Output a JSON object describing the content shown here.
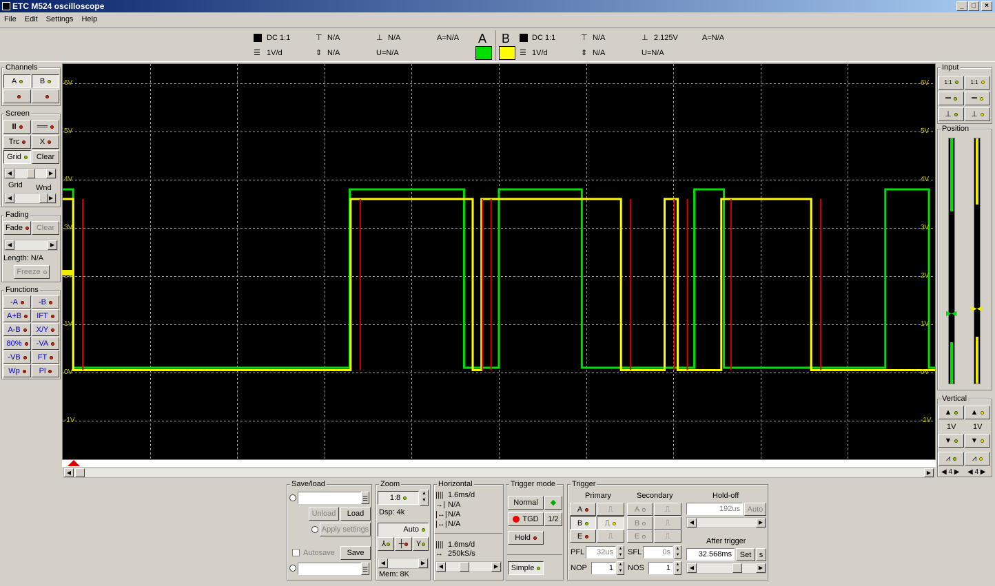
{
  "window": {
    "title": "ETC M524 oscilloscope",
    "min": "_",
    "max": "□",
    "close": "×"
  },
  "menu": [
    "File",
    "Edit",
    "Settings",
    "Help"
  ],
  "header": {
    "a_big": "A",
    "b_big": "B",
    "a": {
      "coupling": "DC 1:1",
      "scale": "1V/d",
      "v1": "N/A",
      "v2": "N/A",
      "trig": "N/A",
      "u": "U=N/A",
      "eq": "A=N/A"
    },
    "b": {
      "coupling": "DC 1:1",
      "scale": "1V/d",
      "v1": "N/A",
      "v2": "N/A",
      "trig": "2.125V",
      "u": "U=N/A",
      "eq": "A=N/A"
    },
    "a_color": "#00e000",
    "b_color": "#ffff00"
  },
  "left": {
    "channels_title": "Channels",
    "ch_a": "A",
    "ch_b": "B",
    "screen_title": "Screen",
    "pause": "II",
    "lines": "══",
    "trc": "Trc",
    "x": "X",
    "grid": "Grid",
    "clear": "Clear",
    "grid_lbl": "Grid",
    "wnd_lbl": "Wnd",
    "fading_title": "Fading",
    "fade": "Fade",
    "fclear": "Clear",
    "length": "Length: N/A",
    "freeze": "Freeze",
    "functions_title": "Functions",
    "functions": [
      [
        "-A",
        "-B"
      ],
      [
        "A+B",
        "IFT"
      ],
      [
        "A-B",
        "X/Y"
      ],
      [
        "80%",
        "-VA"
      ],
      [
        "-VB",
        "FT"
      ],
      [
        "Wp",
        "Pl"
      ]
    ]
  },
  "right": {
    "input_title": "Input",
    "position_title": "Position",
    "vertical_title": "Vertical",
    "ratio": "1:1",
    "va": "1V",
    "vb": "1V",
    "na": "4",
    "nb": "4"
  },
  "scope": {
    "ylabels": [
      "6V",
      "5V",
      "4V",
      "3V",
      "2V",
      "1V",
      "0V",
      "-1V"
    ]
  },
  "chart_data": {
    "type": "line",
    "title": "",
    "ylim": [
      -1.8,
      6.4
    ],
    "series": [
      {
        "name": "A",
        "color": "#00e000",
        "x": [
          0,
          0.012,
          0.012,
          0.329,
          0.329,
          0.46,
          0.46,
          0.5,
          0.5,
          0.595,
          0.595,
          0.724,
          0.724,
          0.758,
          0.758,
          0.943,
          0.943,
          0.993,
          0.993,
          1
        ],
        "y": [
          3.8,
          3.8,
          0.1,
          0.1,
          3.8,
          3.8,
          0.1,
          0.1,
          3.8,
          3.8,
          0.1,
          0.1,
          3.8,
          3.8,
          0.1,
          0.1,
          3.8,
          3.8,
          0.1,
          0.1
        ]
      },
      {
        "name": "B",
        "color": "#ffff00",
        "x": [
          0,
          0.012,
          0.012,
          0.33,
          0.33,
          0.47,
          0.47,
          0.48,
          0.48,
          0.64,
          0.64,
          0.69,
          0.69,
          0.705,
          0.705,
          0.755,
          0.755,
          0.858,
          0.858,
          1
        ],
        "y": [
          3.6,
          3.6,
          0.05,
          0.05,
          3.6,
          3.6,
          0.05,
          0.05,
          3.6,
          3.6,
          0.05,
          0.05,
          3.6,
          3.6,
          0.05,
          0.05,
          3.6,
          3.6,
          0.05,
          0.05
        ]
      }
    ]
  },
  "bottom": {
    "saveload_title": "Save/load",
    "unload": "Unload",
    "load": "Load",
    "apply": "Apply settings",
    "autosave": "Autosave",
    "save": "Save",
    "zoom_title": "Zoom",
    "zoom_val": "1:8",
    "dsp": "Dsp: 4k",
    "auto": "Auto",
    "mem": "Mem: 8K",
    "horizontal_title": "Horizontal",
    "h1": "1.6ms/d",
    "h2": "N/A",
    "h3": "N/A",
    "h4": "N/A",
    "h5": "1.6ms/d",
    "h6": "250kS/s",
    "trigmode_title": "Trigger mode",
    "normal": "Normal",
    "tgd": "TGD",
    "half": "1/2",
    "hold": "Hold",
    "simple": "Simple",
    "trigger_title": "Trigger",
    "primary": "Primary",
    "secondary": "Secondary",
    "holdoff": "Hold-off",
    "holdoff_val": "192us",
    "holdoff_auto": "Auto",
    "after_trigger": "After trigger",
    "after_val": "32.568ms",
    "set": "Set",
    "s": "s",
    "pfl": "PFL",
    "pfl_val": "32us",
    "sfl": "SFL",
    "sfl_val": "0s",
    "nop": "NOP",
    "nop_val": "1",
    "nos": "NOS",
    "nos_val": "1",
    "ta": "A",
    "tb": "B",
    "te": "E"
  }
}
